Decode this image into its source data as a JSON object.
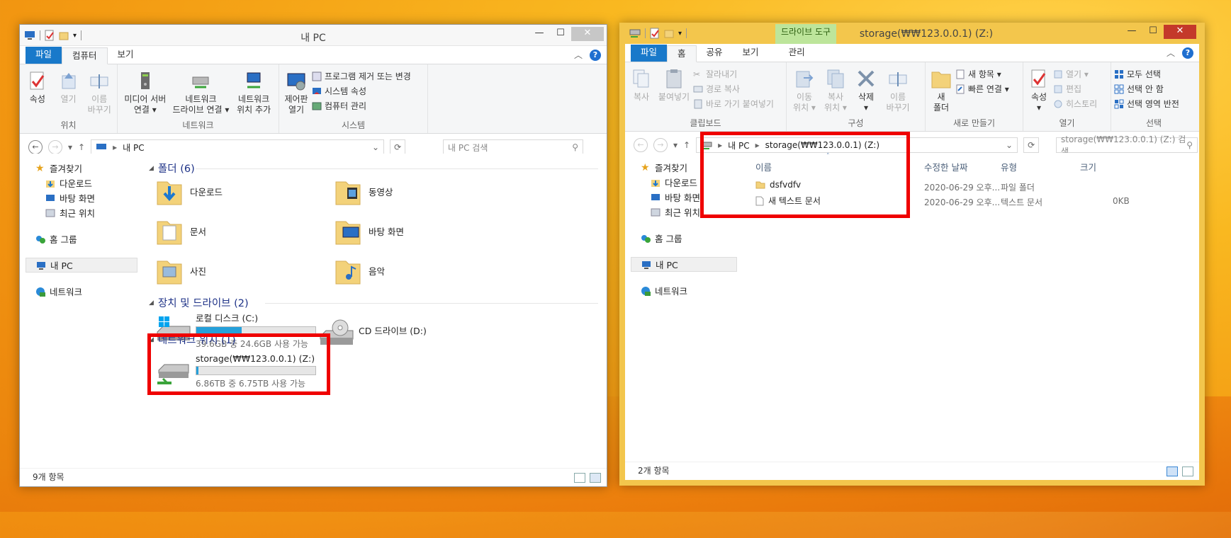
{
  "left_window": {
    "title": "내 PC",
    "tabs": [
      "파일",
      "컴퓨터",
      "보기"
    ],
    "ribbon": {
      "location_group": {
        "name": "위치",
        "props": "속성",
        "open": "열기",
        "rename": "이름\n바꾸기"
      },
      "network_group": {
        "name": "네트워크",
        "media": "미디어 서버\n연결 ▾",
        "map_drive": "네트워크\n드라이브 연결 ▾",
        "add_location": "네트워크\n위치 추가"
      },
      "system_group": {
        "name": "시스템",
        "control_panel": "제어판\n열기",
        "uninstall": "프로그램 제거 또는 변경",
        "sys_props": "시스템 속성",
        "manage": "컴퓨터 관리"
      }
    },
    "address": {
      "path": "내 PC",
      "search_placeholder": "내 PC 검색"
    },
    "nav": {
      "favorites": "즐겨찾기",
      "downloads": "다운로드",
      "desktop": "바탕 화면",
      "recent": "최근 위치",
      "homegroup": "홈 그룹",
      "this_pc": "내 PC",
      "network": "네트워크"
    },
    "sections": {
      "folders": "폴더 (6)",
      "devices": "장치 및 드라이브 (2)",
      "network_locations": "네트워크 위치 (1)"
    },
    "folders": [
      "다운로드",
      "동영상",
      "문서",
      "바탕 화면",
      "사진",
      "음악"
    ],
    "drives": {
      "local": {
        "name": "로컬 디스크 (C:)",
        "free": "39.6GB 중 24.6GB 사용 가능",
        "used_fraction": 0.38
      },
      "cd": {
        "name": "CD 드라이브 (D:)"
      },
      "net": {
        "name": "storage(₩₩123.0.0.1) (Z:)",
        "free": "6.86TB 중 6.75TB 사용 가능",
        "used_fraction": 0.02
      }
    },
    "status": "9개 항목"
  },
  "right_window": {
    "title": "storage(₩₩123.0.0.1) (Z:)",
    "context_tab": "드라이브 도구",
    "context_subtab": "관리",
    "tabs": [
      "파일",
      "홈",
      "공유",
      "보기"
    ],
    "ribbon": {
      "clipboard": {
        "name": "클립보드",
        "copy": "복사",
        "paste": "붙여넣기",
        "cut": "잘라내기",
        "copy_path": "경로 복사",
        "paste_shortcut": "바로 가기 붙여넣기"
      },
      "organize": {
        "name": "구성",
        "move_to": "이동\n위치 ▾",
        "copy_to": "복사\n위치 ▾",
        "delete": "삭제\n▾",
        "rename": "이름\n바꾸기"
      },
      "new": {
        "name": "새로 만들기",
        "new_folder": "새\n폴더",
        "new_item": "새 항목 ▾",
        "easy_access": "빠른 연결 ▾"
      },
      "open": {
        "name": "열기",
        "props": "속성\n▾",
        "open": "열기 ▾",
        "edit": "편집",
        "history": "히스토리"
      },
      "select": {
        "name": "선택",
        "select_all": "모두 선택",
        "select_none": "선택 안 함",
        "invert": "선택 영역 반전"
      }
    },
    "address": {
      "root": "내 PC",
      "current": "storage(₩₩123.0.0.1) (Z:)",
      "search_placeholder": "storage(₩₩123.0.0.1) (Z:) 검색"
    },
    "nav": {
      "favorites": "즐겨찾기",
      "downloads": "다운로드",
      "desktop": "바탕 화면",
      "recent": "최근 위치",
      "homegroup": "홈 그룹",
      "this_pc": "내 PC",
      "network": "네트워크"
    },
    "columns": {
      "name": "이름",
      "modified": "수정한 날짜",
      "type": "유형",
      "size": "크기"
    },
    "files": [
      {
        "name": "dsfvdfv",
        "modified": "2020-06-29 오후...",
        "type": "파일 폴더",
        "size": ""
      },
      {
        "name": "새 텍스트 문서",
        "modified": "2020-06-29 오후...",
        "type": "텍스트 문서",
        "size": "0KB"
      }
    ],
    "status": "2개 항목"
  },
  "colors": {
    "file_tab": "#1979ca",
    "highlight_box": "#ef0000",
    "right_frame": "#f3c64c",
    "drive_bar": "#26a0da",
    "section_text": "#1e3287"
  }
}
